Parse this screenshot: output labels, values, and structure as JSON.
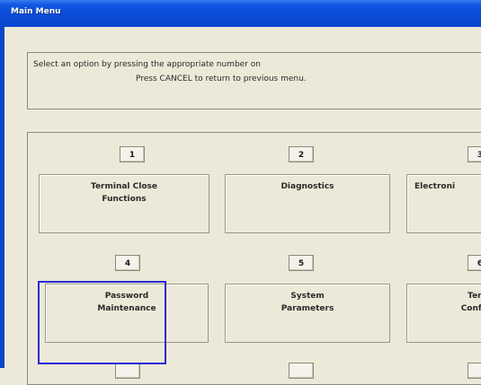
{
  "window": {
    "title": "Main Menu"
  },
  "instructions": {
    "line1": "Select an option by pressing the appropriate number on",
    "line2": "Press CANCEL to return to previous menu."
  },
  "options": [
    {
      "number": "1",
      "label": "Terminal Close\nFunctions"
    },
    {
      "number": "2",
      "label": "Diagnostics"
    },
    {
      "number": "3",
      "label": "Electroni"
    },
    {
      "number": "4",
      "label": "Password\nMaintenance"
    },
    {
      "number": "5",
      "label": "System\nParameters"
    },
    {
      "number": "6",
      "label": "Term\nConfig"
    }
  ],
  "colors": {
    "titlebar": "#0a46cc",
    "focus_outline": "#2a2ad4",
    "window_bg": "#ece9d8"
  }
}
